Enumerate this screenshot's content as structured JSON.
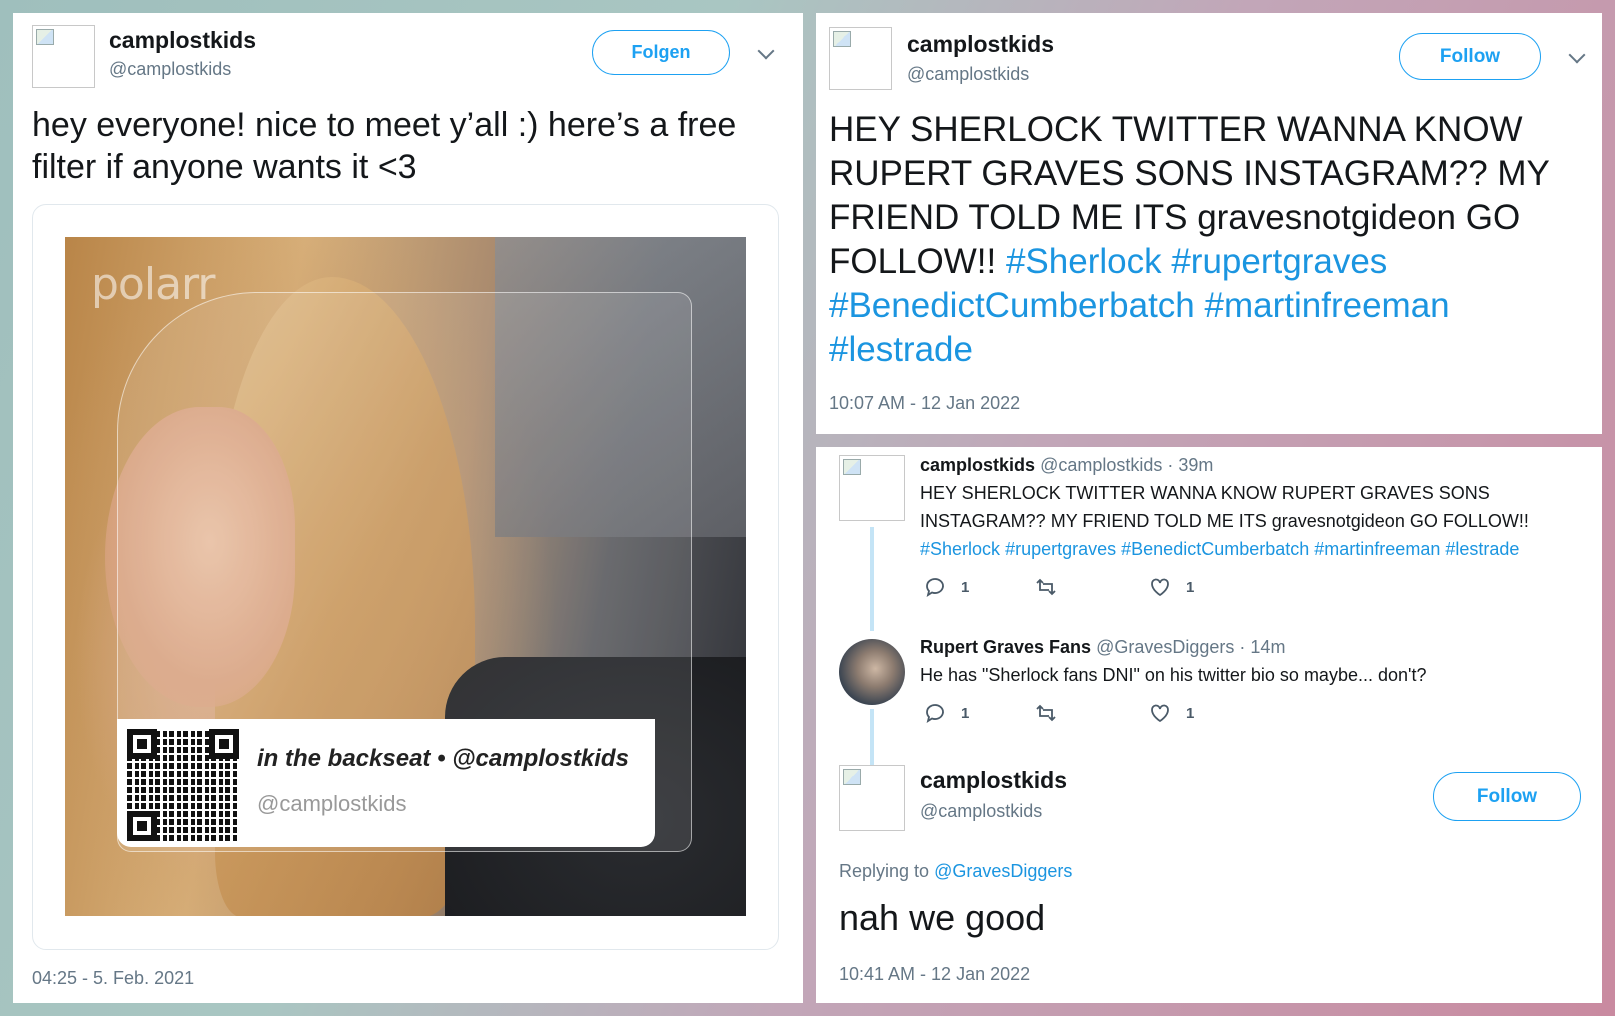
{
  "tweet1": {
    "name": "camplostkids",
    "handle": "@camplostkids",
    "follow_label": "Folgen",
    "text": "hey everyone! nice to meet y’all :) here’s a free filter if anyone wants it <3",
    "media": {
      "logo": "polarr",
      "caption_title": "in the backseat • @camplostkids",
      "caption_handle": "@camplostkids"
    },
    "timestamp": "04:25 - 5. Feb. 2021"
  },
  "tweet2": {
    "name": "camplostkids",
    "handle": "@camplostkids",
    "follow_label": "Follow",
    "text_plain": "HEY SHERLOCK TWITTER WANNA KNOW RUPERT GRAVES SONS INSTAGRAM?? MY FRIEND TOLD ME ITS gravesnotgideon GO FOLLOW!! ",
    "hashtags": [
      "#Sherlock",
      "#rupertgraves",
      "#BenedictCumberbatch",
      "#martinfreeman",
      "#lestrade"
    ],
    "timestamp": "10:07 AM - 12 Jan 2022"
  },
  "tweet3": {
    "parent": {
      "name": "camplostkids",
      "handle": "@camplostkids",
      "age": "· 39m",
      "text_line1": "HEY SHERLOCK TWITTER WANNA KNOW RUPERT GRAVES SONS",
      "text_line2": "INSTAGRAM?? MY FRIEND TOLD ME ITS gravesnotgideon GO FOLLOW!!",
      "hashtags": [
        "#Sherlock",
        "#rupertgraves",
        "#BenedictCumberbatch",
        "#martinfreeman",
        "#lestrade"
      ],
      "reply_count": "1",
      "like_count": "1"
    },
    "reply": {
      "name": "Rupert Graves Fans",
      "handle": "@GravesDiggers",
      "age": "· 14m",
      "text": "He has \"Sherlock fans DNI\" on his twitter bio so maybe... don't?",
      "reply_count": "1",
      "like_count": "1"
    },
    "main": {
      "name": "camplostkids",
      "handle": "@camplostkids",
      "follow_label": "Follow",
      "replying_prefix": "Replying to",
      "replying_to": "@GravesDiggers",
      "text": "nah we good",
      "timestamp": "10:41 AM - 12 Jan 2022"
    }
  },
  "colors": {
    "link": "#1b95e0",
    "follow_border": "#1da1f2",
    "muted": "#657786",
    "text": "#14171a"
  },
  "icons": [
    "chevron-down-icon",
    "reply-icon",
    "retweet-icon",
    "like-icon",
    "qr-code-icon"
  ]
}
